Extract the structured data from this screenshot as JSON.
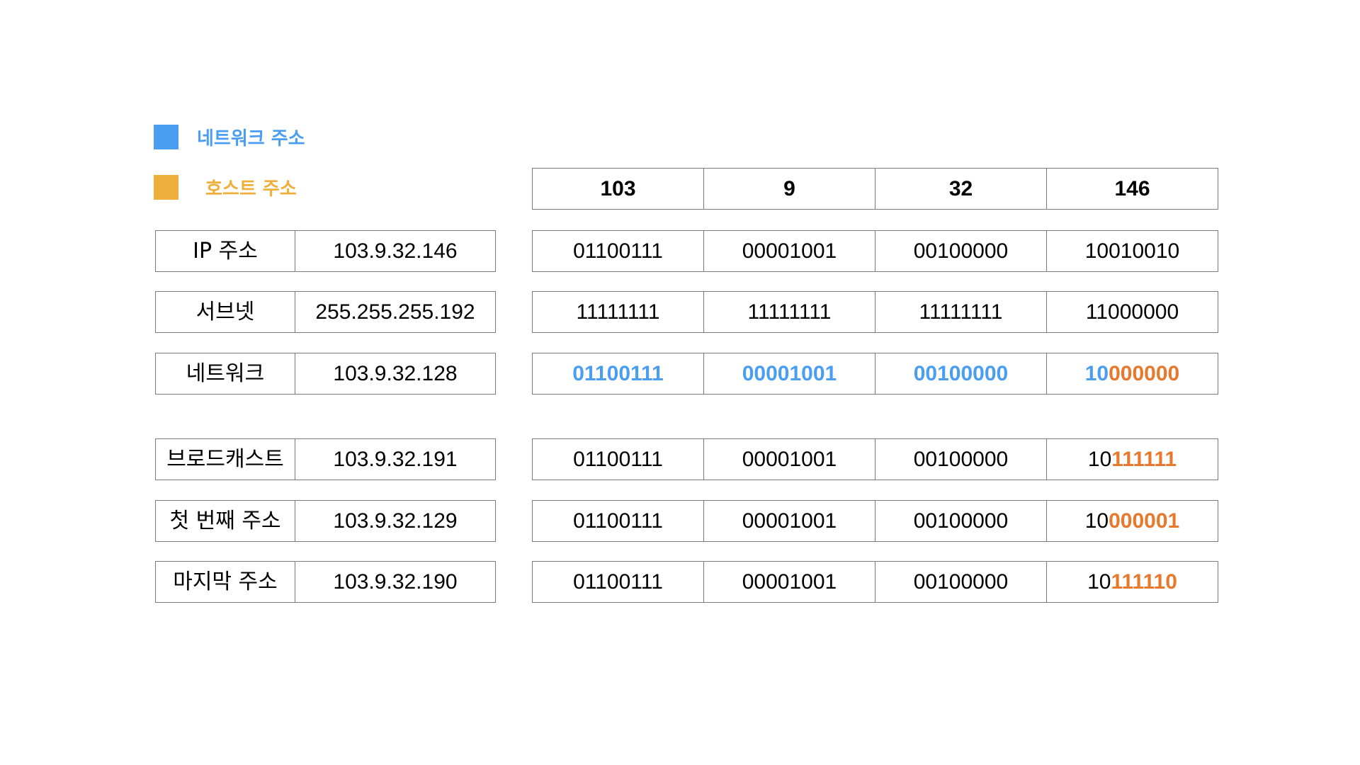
{
  "legend": {
    "network_label": "네트워크 주소",
    "network_color": "#4A9EF2",
    "host_label": "호스트 주소",
    "host_color": "#F0AF3C"
  },
  "octet_headers": [
    "103",
    "9",
    "32",
    "146"
  ],
  "rows": {
    "ip": {
      "label": "IP 주소",
      "value": "103.9.32.146",
      "bits": [
        "01100111",
        "00001001",
        "00100000",
        "10010010"
      ]
    },
    "subnet": {
      "label": "서브넷",
      "value": "255.255.255.192",
      "bits": [
        "11111111",
        "11111111",
        "11111111",
        "11000000"
      ]
    },
    "network": {
      "label": "네트워크",
      "value": "103.9.32.128",
      "bits": [
        "01100111",
        "00001001",
        "00100000"
      ],
      "last_network_part": "10",
      "last_host_part": "000000"
    },
    "broadcast": {
      "label": "브로드캐스트",
      "value": "103.9.32.191",
      "bits": [
        "01100111",
        "00001001",
        "00100000"
      ],
      "last_network_part": "10",
      "last_host_part": "111111"
    },
    "first": {
      "label": "첫 번째 주소",
      "value": "103.9.32.129",
      "bits": [
        "01100111",
        "00001001",
        "00100000"
      ],
      "last_network_part": "10",
      "last_host_part": "000001"
    },
    "last": {
      "label": "마지막 주소",
      "value": "103.9.32.190",
      "bits": [
        "01100111",
        "00001001",
        "00100000"
      ],
      "last_network_part": "10",
      "last_host_part": "111110"
    }
  },
  "highlight_colors": {
    "network_bits": "#4A9EF2",
    "host_bits": "#E8792C"
  }
}
